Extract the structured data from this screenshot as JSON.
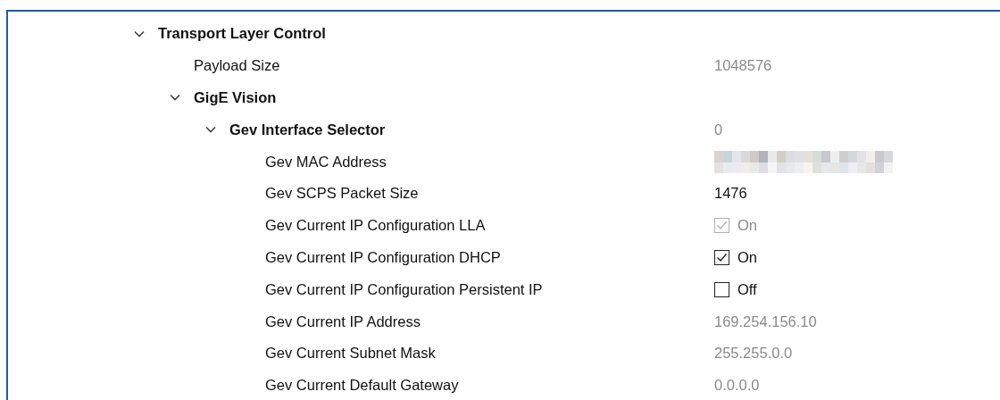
{
  "tree": [
    {
      "label": "Transport Layer Control",
      "kind": "category",
      "expanded": true,
      "children": [
        {
          "label": "Payload Size",
          "kind": "value",
          "value": "1048576",
          "disabled": true
        },
        {
          "label": "GigE Vision",
          "kind": "category",
          "expanded": true,
          "children": [
            {
              "label": "Gev Interface Selector",
              "kind": "category",
              "expanded": true,
              "value": "0",
              "disabled": true,
              "children": [
                {
                  "label": "Gev MAC Address",
                  "kind": "redacted"
                },
                {
                  "label": "Gev SCPS Packet Size",
                  "kind": "value",
                  "value": "1476",
                  "disabled": false
                },
                {
                  "label": "Gev Current IP Configuration LLA",
                  "kind": "checkbox",
                  "checked": true,
                  "value": "On",
                  "disabled": true
                },
                {
                  "label": "Gev Current IP Configuration DHCP",
                  "kind": "checkbox",
                  "checked": true,
                  "value": "On",
                  "disabled": false
                },
                {
                  "label": "Gev Current IP Configuration Persistent IP",
                  "kind": "checkbox",
                  "checked": false,
                  "value": "Off",
                  "disabled": false
                },
                {
                  "label": "Gev Current IP Address",
                  "kind": "value",
                  "value": "169.254.156.10",
                  "disabled": true
                },
                {
                  "label": "Gev Current Subnet Mask",
                  "kind": "value",
                  "value": "255.255.0.0",
                  "disabled": true
                },
                {
                  "label": "Gev Current Default Gateway",
                  "kind": "value",
                  "value": "0.0.0.0",
                  "disabled": true
                }
              ]
            }
          ]
        }
      ]
    }
  ]
}
